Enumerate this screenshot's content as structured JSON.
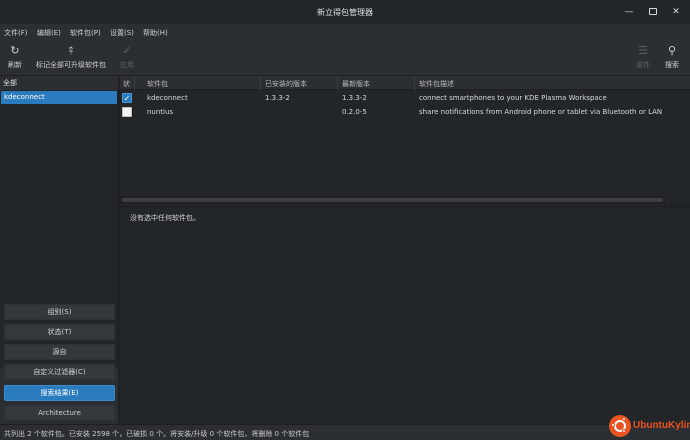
{
  "window": {
    "title": "新立得包管理器"
  },
  "menu": [
    "文件(F)",
    "编辑(E)",
    "软件包(P)",
    "设置(S)",
    "帮助(H)"
  ],
  "toolbar": {
    "reload": "刷新",
    "mark_all": "标记全部可升级软件包",
    "apply": "应用",
    "properties": "属性",
    "search": "搜索"
  },
  "sidebar": {
    "header": "全部",
    "items": [
      "kdeconnect"
    ],
    "filters": [
      "组别(S)",
      "状态(T)",
      "源自",
      "自定义过滤器(C)",
      "搜索结果(E)",
      "Architecture"
    ],
    "active_filter": "搜索结果(E)"
  },
  "table": {
    "columns": [
      "状",
      "软件包",
      "已安装的版本",
      "最新版本",
      "软件包描述"
    ],
    "rows": [
      {
        "checked": true,
        "package": "kdeconnect",
        "installed": "1.3.3-2",
        "latest": "1.3.3-2",
        "description": "connect smartphones to your KDE Plasma Workspace"
      },
      {
        "checked": false,
        "package": "nuntius",
        "installed": "",
        "latest": "0.2.0-5",
        "description": "share notifications from Android phone or tablet via Bluetooth or LAN"
      }
    ]
  },
  "details": {
    "message": "没有选中任何软件包。"
  },
  "statusbar": {
    "text": "共列出 2 个软件包。已安装 2598 个，已破损 0 个。将安装/升级 0 个软件包，将删除 0 个软件包"
  },
  "logo": {
    "text": "UbuntuKylin"
  },
  "colors": {
    "accent": "#2a7bbd",
    "background": "#232629",
    "brand": "#e95420"
  }
}
